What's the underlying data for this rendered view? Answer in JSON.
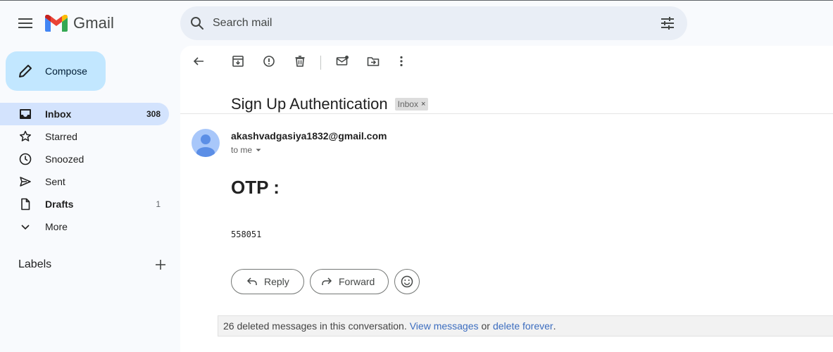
{
  "app": {
    "name": "Gmail"
  },
  "search": {
    "placeholder": "Search mail"
  },
  "compose": {
    "label": "Compose"
  },
  "nav": [
    {
      "label": "Inbox",
      "count": "308",
      "icon": "inbox-icon",
      "active": true,
      "bold": true
    },
    {
      "label": "Starred",
      "count": "",
      "icon": "star-icon"
    },
    {
      "label": "Snoozed",
      "count": "",
      "icon": "clock-icon"
    },
    {
      "label": "Sent",
      "count": "",
      "icon": "send-icon"
    },
    {
      "label": "Drafts",
      "count": "1",
      "icon": "draft-icon",
      "bold": true
    },
    {
      "label": "More",
      "count": "",
      "icon": "chevron-down-icon"
    }
  ],
  "labels": {
    "title": "Labels"
  },
  "message": {
    "subject": "Sign Up Authentication",
    "badge": "Inbox",
    "badge_close": "×",
    "sender": "akashvadgasiya1832@gmail.com",
    "recipient": "to me",
    "body_heading": "OTP :",
    "body_value": "558051"
  },
  "actions": {
    "reply": "Reply",
    "forward": "Forward"
  },
  "deleted_notice": {
    "text": "26 deleted messages in this conversation.",
    "view_link": "View messages",
    "or": "or",
    "delete_link": "delete forever",
    "period": "."
  },
  "colors": {
    "accent": "#c2e7ff",
    "active_nav": "#d3e3fd",
    "link": "#3c6dbf"
  }
}
